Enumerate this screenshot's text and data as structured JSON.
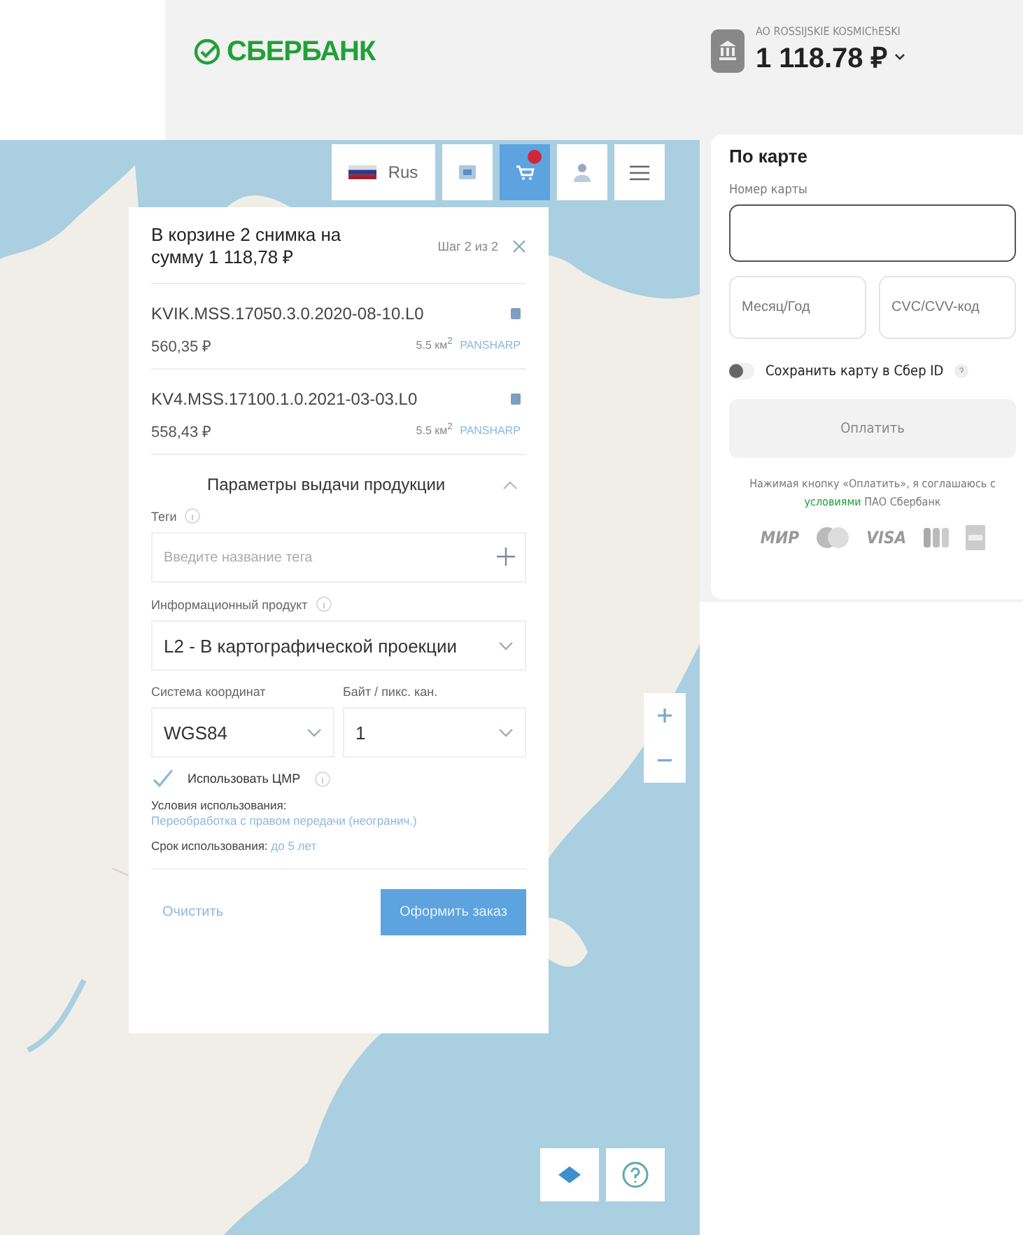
{
  "header": {
    "logo": "СБЕРБАНК",
    "merchant": "AO ROSSIJSKIE KOSMIChESKI",
    "amount": "1 118.78 ₽"
  },
  "payment": {
    "title": "По карте",
    "card_number_label": "Номер карты",
    "expiry_placeholder": "Месяц/Год",
    "cvc_placeholder": "CVC/CVV-код",
    "save_card": {
      "label": "Сохранить карту в Сбер ID",
      "on": false
    },
    "pay_button": {
      "label": "Оплатить",
      "disabled": true
    },
    "legal": {
      "before": "Нажимая кнопку «Оплатить», я соглашаюсь с",
      "link": "условиями",
      "after": "ПАО Сбербанк"
    },
    "card_logos": [
      {
        "kind": "text",
        "label": "МИР"
      },
      {
        "kind": "mastercard"
      },
      {
        "kind": "text",
        "label": "VISA"
      },
      {
        "kind": "jcb"
      },
      {
        "kind": "amex"
      }
    ]
  },
  "map_app": {
    "toolbar": [
      {
        "kind": "language",
        "label": "Rus",
        "selected": false
      },
      {
        "kind": "image",
        "selected": false
      },
      {
        "kind": "cart",
        "selected": true
      },
      {
        "kind": "user",
        "selected": false
      },
      {
        "kind": "menu",
        "selected": false
      }
    ],
    "cart": {
      "title": "В корзине 2 снимка на сумму 1 118,78 ₽",
      "step": "Шаг 2 из 2",
      "items": [
        {
          "name": "KVIK.MSS.17050.3.0.2020-08-10.L0",
          "price": "560,35 ₽",
          "area": "5.5 км$^{2}$",
          "mode": "PANSHARP"
        },
        {
          "name": "KV4.MSS.17100.1.0.2021-03-03.L0",
          "price": "558,43 ₽",
          "area": "5.5 км$^{2}$",
          "mode": "PANSHARP"
        }
      ],
      "params": {
        "title": "Параметры выдачи продукции",
        "expanded": true,
        "tags": {
          "label": "Теги",
          "placeholder": "Введите название тега"
        },
        "product": {
          "label": "Информационный продукт",
          "value": "L2 - В картографической проекции"
        },
        "crs": {
          "label": "Система координат",
          "value": "WGS84"
        },
        "bytes": {
          "label": "Байт / пикс. кан.",
          "value": "1"
        },
        "dem": {
          "label": "Использовать ЦМР",
          "checked": true
        },
        "terms": {
          "label": "Условия использования:",
          "value": "Переобработка с правом передачи (неогранич.)"
        },
        "period": {
          "label": "Срок использования:",
          "value": "до 5 лет"
        }
      },
      "clear": "Очистить",
      "submit": "Оформить заказ"
    }
  }
}
